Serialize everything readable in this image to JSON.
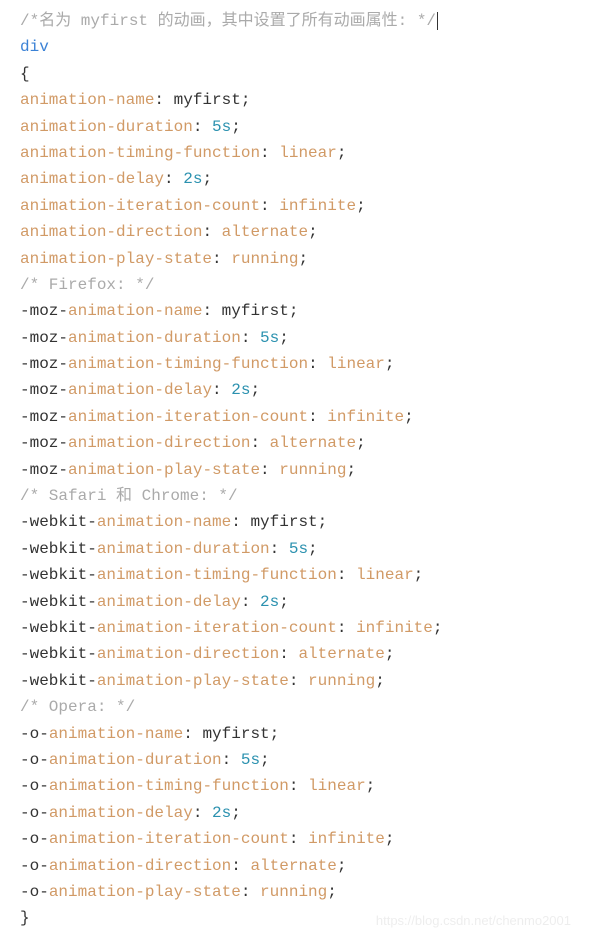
{
  "code": {
    "comment_top": "/*名为 myfirst 的动画，其中设置了所有动画属性: */",
    "selector": "div",
    "brace_open": "{",
    "brace_close": "}",
    "standard": {
      "name_prop": "animation-name",
      "name_val": "myfirst",
      "duration_prop": "animation-duration",
      "duration_val": "5s",
      "timing_prop": "animation-timing-function",
      "timing_val": "linear",
      "delay_prop": "animation-delay",
      "delay_val": "2s",
      "iter_prop": "animation-iteration-count",
      "iter_val": "infinite",
      "dir_prop": "animation-direction",
      "dir_val": "alternate",
      "play_prop": "animation-play-state",
      "play_val": "running"
    },
    "firefox_comment": "/* Firefox: */",
    "moz": {
      "prefix": "-moz-",
      "name_prop": "animation-name",
      "name_val": "myfirst",
      "duration_prop": "animation-duration",
      "duration_val": "5s",
      "timing_prop": "animation-timing-function",
      "timing_val": "linear",
      "delay_prop": "animation-delay",
      "delay_val": "2s",
      "iter_prop": "animation-iteration-count",
      "iter_val": "infinite",
      "dir_prop": "animation-direction",
      "dir_val": "alternate",
      "play_prop": "animation-play-state",
      "play_val": "running"
    },
    "safari_comment": "/* Safari 和 Chrome: */",
    "webkit": {
      "prefix": "-webkit-",
      "name_prop": "animation-name",
      "name_val": "myfirst",
      "duration_prop": "animation-duration",
      "duration_val": "5s",
      "timing_prop": "animation-timing-function",
      "timing_val": "linear",
      "delay_prop": "animation-delay",
      "delay_val": "2s",
      "iter_prop": "animation-iteration-count",
      "iter_val": "infinite",
      "dir_prop": "animation-direction",
      "dir_val": "alternate",
      "play_prop": "animation-play-state",
      "play_val": "running"
    },
    "opera_comment": "/* Opera: */",
    "o": {
      "prefix": "-o-",
      "name_prop": "animation-name",
      "name_val": "myfirst",
      "duration_prop": "animation-duration",
      "duration_val": "5s",
      "timing_prop": "animation-timing-function",
      "timing_val": "linear",
      "delay_prop": "animation-delay",
      "delay_val": "2s",
      "iter_prop": "animation-iteration-count",
      "iter_val": "infinite",
      "dir_prop": "animation-direction",
      "dir_val": "alternate",
      "play_prop": "animation-play-state",
      "play_val": "running"
    }
  },
  "watermark": "https://blog.csdn.net/chenmo2001"
}
